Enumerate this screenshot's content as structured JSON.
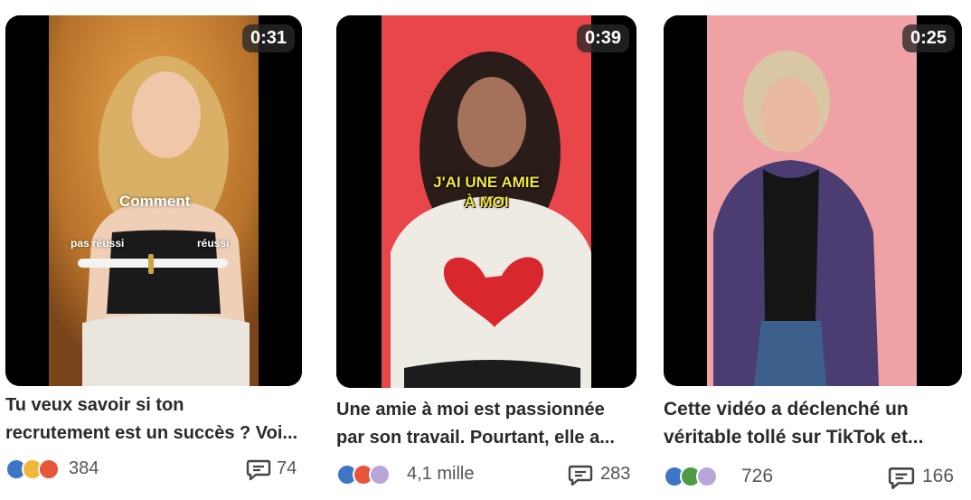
{
  "cards": [
    {
      "duration": "0:31",
      "title_line1": "Tu veux savoir si ton",
      "title_line2": "recrutement est un succès ? Voi...",
      "overlay": {
        "word": "Comment",
        "left_label": "pas réussi",
        "right_label": "réussi"
      },
      "reactions": [
        "like-icon",
        "idea-icon",
        "love-icon"
      ],
      "reaction_count": "384",
      "comment_count": "74"
    },
    {
      "duration": "0:39",
      "title_line1": "Une amie à moi est passionnée",
      "title_line2": "par son travail. Pourtant, elle a...",
      "subtitle_line1": "J'AI UNE AMIE",
      "subtitle_line2": "À MOI",
      "reactions": [
        "like-icon",
        "love-icon",
        "support-icon"
      ],
      "reaction_count": "4,1 mille",
      "comment_count": "283"
    },
    {
      "duration": "0:25",
      "title_line1": "Cette vidéo a déclenché un",
      "title_line2": "véritable tollé sur TikTok et...",
      "reactions": [
        "like-icon",
        "celebrate-icon",
        "support-icon"
      ],
      "reaction_count": "726",
      "comment_count": "166"
    }
  ],
  "colors": {
    "card1_bg": "#c98a3a",
    "card2_bg": "#e8464a",
    "card3_bg": "#f0a1a6",
    "like": "#3d76c4",
    "love": "#e6553a",
    "idea": "#f2b63b",
    "support": "#b9a6d9",
    "celebrate": "#4f9a44"
  }
}
